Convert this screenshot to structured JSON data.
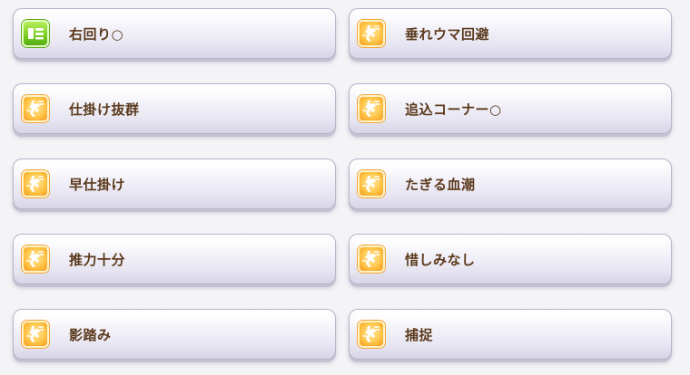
{
  "colors": {
    "card_text": "#5b3a1c",
    "speed_icon_orange": "#ffc64a",
    "condition_icon_green": "#79cc22"
  },
  "skills": [
    {
      "label": "右回り○",
      "icon": "green-condition-icon"
    },
    {
      "label": "垂れウマ回避",
      "icon": "orange-speed-icon"
    },
    {
      "label": "仕掛け抜群",
      "icon": "orange-speed-icon"
    },
    {
      "label": "追込コーナー○",
      "icon": "orange-speed-icon"
    },
    {
      "label": "早仕掛け",
      "icon": "orange-speed-icon"
    },
    {
      "label": "たぎる血潮",
      "icon": "orange-speed-icon"
    },
    {
      "label": "推力十分",
      "icon": "orange-speed-icon"
    },
    {
      "label": "惜しみなし",
      "icon": "orange-speed-icon"
    },
    {
      "label": "影踏み",
      "icon": "orange-speed-icon"
    },
    {
      "label": "捕捉",
      "icon": "orange-speed-icon"
    }
  ]
}
